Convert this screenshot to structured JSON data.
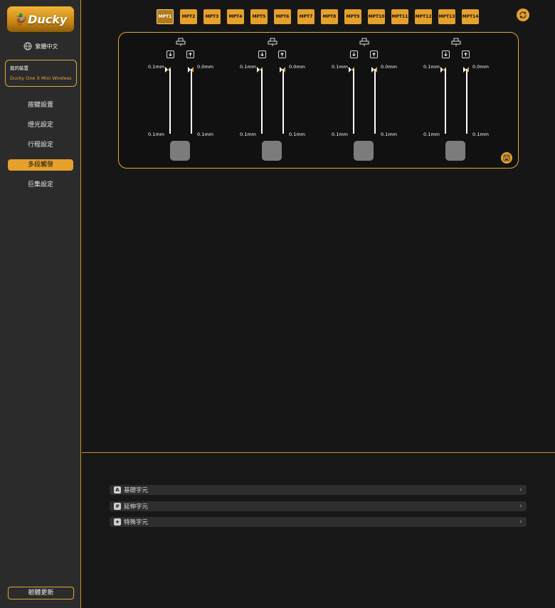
{
  "sidebar": {
    "logo_text": "Ducky",
    "language": "繁體中文",
    "device": {
      "label": "我的裝置",
      "name": "Ducky One X Mini Wireless"
    },
    "nav": [
      {
        "label": "按鍵設置",
        "active": false
      },
      {
        "label": "燈光設定",
        "active": false
      },
      {
        "label": "行程設定",
        "active": false
      },
      {
        "label": "多段觸發",
        "active": true
      },
      {
        "label": "巨集設定",
        "active": false
      }
    ],
    "update_button": "韌體更新"
  },
  "tabs": [
    "MPT1",
    "MPT2",
    "MPT3",
    "MPT4",
    "MPT5",
    "MPT6",
    "MPT7",
    "MPT8",
    "MPT9",
    "MPT10",
    "MPT11",
    "MPT12",
    "MPT13",
    "MPT14"
  ],
  "active_tab": 0,
  "groups": [
    {
      "press_top": "0.1mm",
      "release_top": "0.0mm",
      "press_bottom": "0.1mm",
      "release_bottom": "0.1mm"
    },
    {
      "press_top": "0.1mm",
      "release_top": "0.0mm",
      "press_bottom": "0.1mm",
      "release_bottom": "0.1mm"
    },
    {
      "press_top": "0.1mm",
      "release_top": "0.0mm",
      "press_bottom": "0.1mm",
      "release_bottom": "0.1mm"
    },
    {
      "press_top": "0.1mm",
      "release_top": "0.0mm",
      "press_bottom": "0.1mm",
      "release_bottom": "0.1mm"
    }
  ],
  "char_sections": [
    {
      "icon": "A",
      "label": "基礎字元"
    },
    {
      "icon": "#",
      "label": "延伸字元"
    },
    {
      "icon": "★",
      "label": "特殊字元"
    }
  ],
  "colors": {
    "accent": "#e6a02c",
    "sidebar": "#2b2b2b",
    "background": "#161616"
  }
}
